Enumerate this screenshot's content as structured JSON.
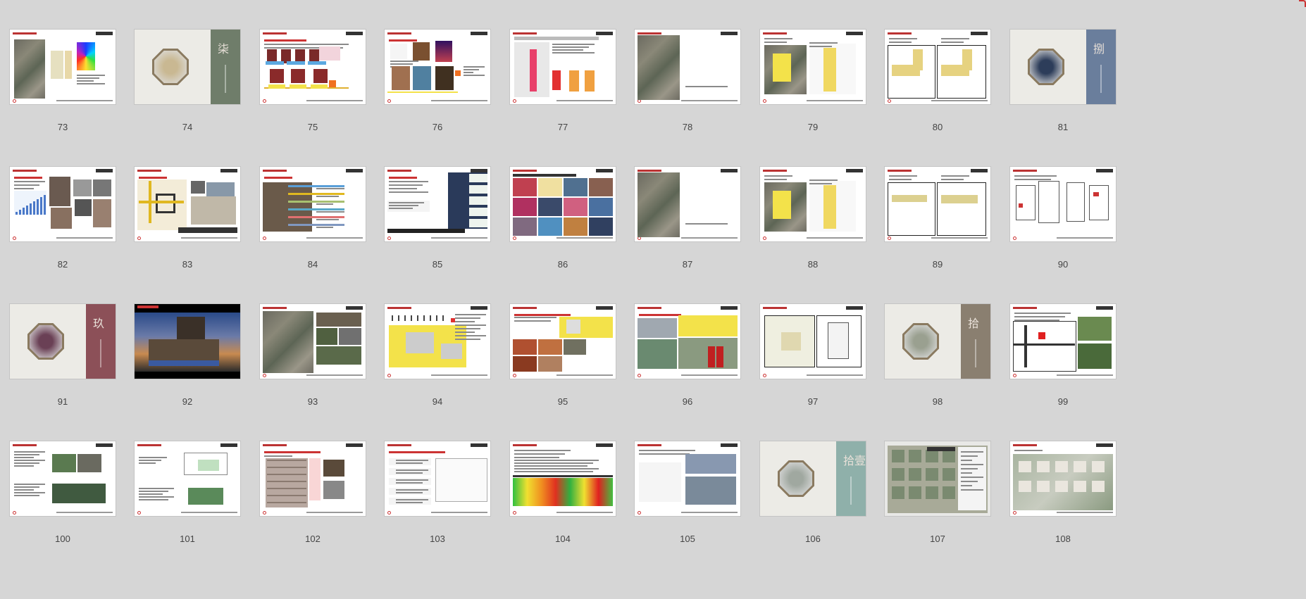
{
  "slides": [
    {
      "num": "73",
      "kind": "plan-heat"
    },
    {
      "num": "74",
      "kind": "cover",
      "band": "#6f7d6a",
      "oct": "#c9b892",
      "glyph": "柒"
    },
    {
      "num": "75",
      "kind": "figures"
    },
    {
      "num": "76",
      "kind": "photos-sketch"
    },
    {
      "num": "77",
      "kind": "plan-pink"
    },
    {
      "num": "78",
      "kind": "aerial-half"
    },
    {
      "num": "79",
      "kind": "aerial-yellow"
    },
    {
      "num": "80",
      "kind": "twin-plan"
    },
    {
      "num": "81",
      "kind": "cover",
      "band": "#6a7e9c",
      "oct": "#2d3d5a",
      "glyph": "捌"
    },
    {
      "num": "82",
      "kind": "chart-photos"
    },
    {
      "num": "83",
      "kind": "map-photos"
    },
    {
      "num": "84",
      "kind": "photo-bars"
    },
    {
      "num": "85",
      "kind": "night-photos"
    },
    {
      "num": "86",
      "kind": "collage"
    },
    {
      "num": "87",
      "kind": "aerial-half"
    },
    {
      "num": "88",
      "kind": "aerial-yellow"
    },
    {
      "num": "89",
      "kind": "twin-plan-thin"
    },
    {
      "num": "90",
      "kind": "floor-plans"
    },
    {
      "num": "91",
      "kind": "cover",
      "band": "#8c5058",
      "oct": "#6a4055",
      "glyph": "玖"
    },
    {
      "num": "92",
      "kind": "render"
    },
    {
      "num": "93",
      "kind": "aerial-photos"
    },
    {
      "num": "94",
      "kind": "yellow-plan"
    },
    {
      "num": "95",
      "kind": "plan-photos"
    },
    {
      "num": "96",
      "kind": "yellow-collage"
    },
    {
      "num": "97",
      "kind": "site-plan-box"
    },
    {
      "num": "98",
      "kind": "cover",
      "band": "#8a7f70",
      "oct": "#9aa090",
      "glyph": "拾"
    },
    {
      "num": "99",
      "kind": "plan-grid"
    },
    {
      "num": "100",
      "kind": "text-photos"
    },
    {
      "num": "101",
      "kind": "text-diagram"
    },
    {
      "num": "102",
      "kind": "building"
    },
    {
      "num": "103",
      "kind": "list-sketch"
    },
    {
      "num": "104",
      "kind": "heatmap"
    },
    {
      "num": "105",
      "kind": "diagram-photos"
    },
    {
      "num": "106",
      "kind": "cover",
      "band": "#8fb0aa",
      "oct": "#a0a8a0",
      "glyph": "拾壹"
    },
    {
      "num": "107",
      "kind": "masterplan"
    },
    {
      "num": "108",
      "kind": "axo"
    }
  ]
}
